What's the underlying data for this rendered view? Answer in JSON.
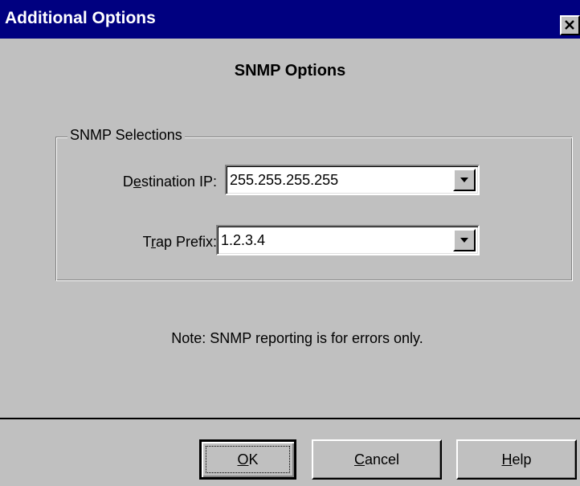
{
  "window": {
    "title": "Additional Options",
    "close_icon": "close-icon"
  },
  "heading": "SNMP Options",
  "group": {
    "legend": "SNMP Selections",
    "destination": {
      "label_pre": "D",
      "label_mnemonic": "e",
      "label_post": "stination IP:",
      "value": "255.255.255.255"
    },
    "trap": {
      "label_pre": "T",
      "label_mnemonic": "r",
      "label_post": "ap Prefix:",
      "value": "1.2.3.4"
    }
  },
  "note": "Note: SNMP reporting is for errors only.",
  "buttons": {
    "ok": {
      "mnemonic": "O",
      "rest": "K"
    },
    "cancel": {
      "mnemonic": "C",
      "rest": "ancel"
    },
    "help": {
      "mnemonic": "H",
      "rest": "elp"
    }
  },
  "colors": {
    "titlebar": "#000080",
    "face": "#c0c0c0"
  }
}
